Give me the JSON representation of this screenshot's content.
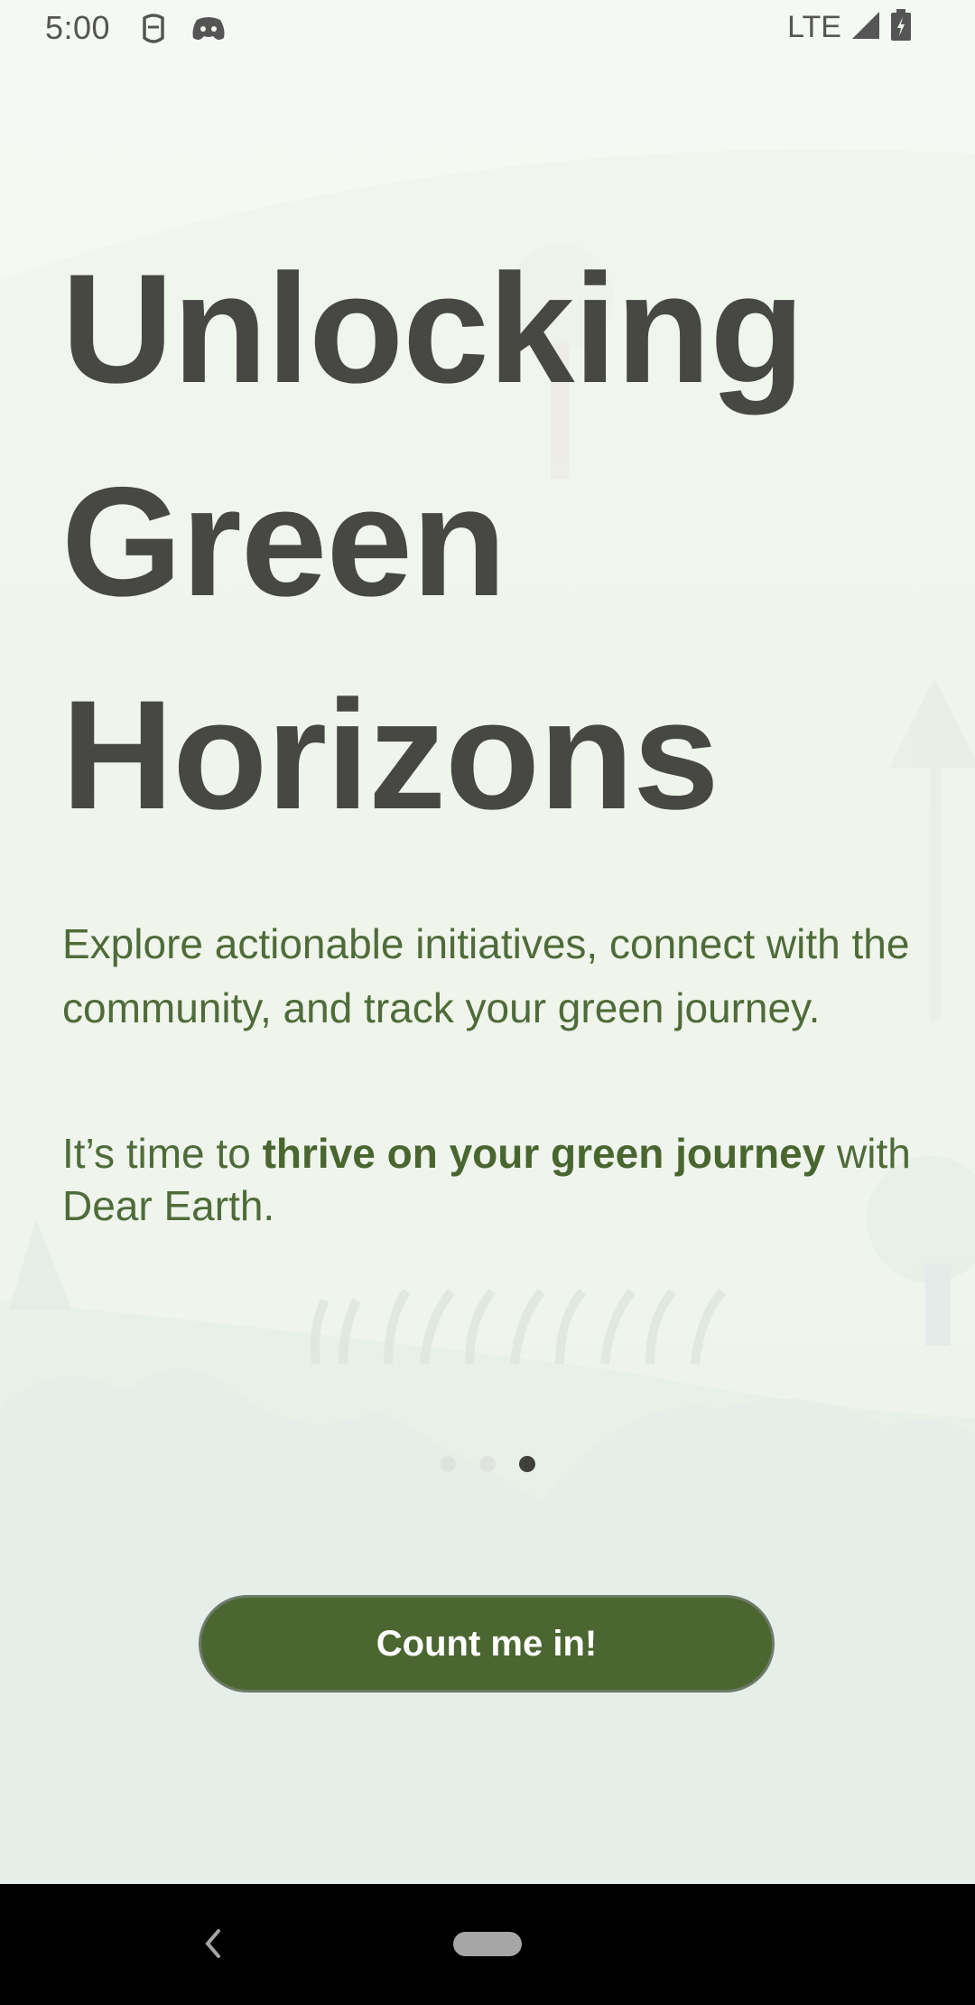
{
  "status_bar": {
    "time": "5:00",
    "network": "LTE",
    "icons": [
      "mascot-notification-icon",
      "discord-icon",
      "signal-icon",
      "battery-charging-icon"
    ]
  },
  "onboarding": {
    "headline_lines": [
      "Unlocking",
      "Green",
      "Horizons"
    ],
    "intro": "Explore actionable initiatives, connect with the community, and track your green journey.",
    "cta_prefix": "It’s time to ",
    "cta_emphasis": "thrive on your green journey",
    "cta_suffix": " with Dear Earth.",
    "page_count": 3,
    "active_page": 3,
    "button_label": "Count me in!"
  },
  "nav_bar": {
    "icons": [
      "back-icon",
      "home-pill-icon"
    ]
  },
  "colors": {
    "headline": "#474843",
    "body_text": "#4f6b3a",
    "button": "#4b6630",
    "background": "#f3f8f1"
  }
}
